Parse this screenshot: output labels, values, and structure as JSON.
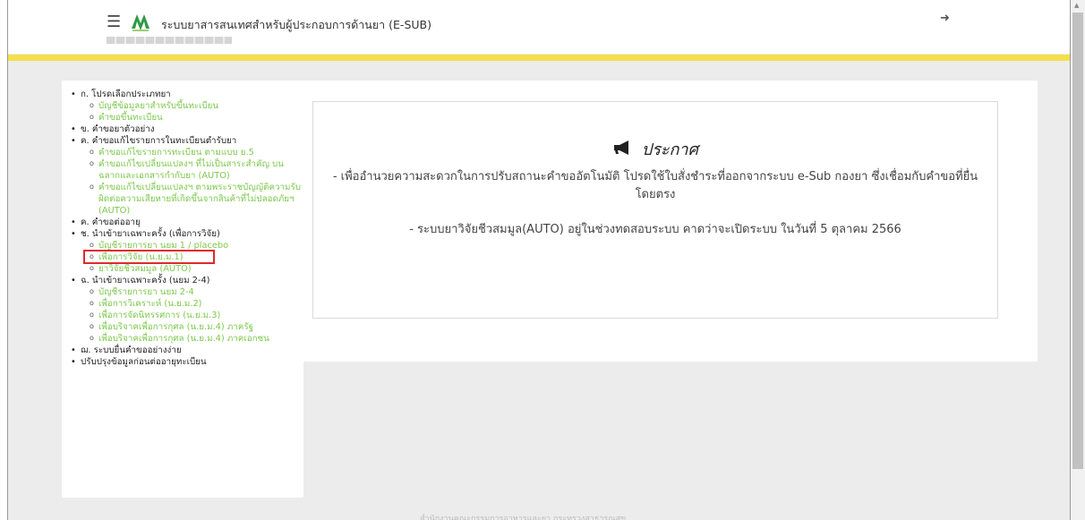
{
  "header": {
    "title": "ระบบยาสารสนเทศสำหรับผู้ประกอบการด้านยา (E-SUB)",
    "menu_icon": "menu-icon",
    "logout_icon": "sign-out-icon",
    "accent_color": "#f3e04a"
  },
  "sidebar": {
    "items": [
      {
        "label": "ก. โปรดเลือกประเภทยา",
        "children": [
          "บัญชีข้อมูลยาสำหรับขึ้นทะเบียน",
          "คำขอขึ้นทะเบียน"
        ]
      },
      {
        "label": "ข. คำขอยาตัวอย่าง",
        "children": []
      },
      {
        "label": "ค. คำขอแก้ไขรายการในทะเบียนตำรับยา",
        "children": [
          "คำขอแก้ไขรายการทะเบียน ตามแบบ ย.5",
          "คำขอแก้ไขเปลี่ยนแปลงฯ ที่ไม่เป็นสาระสำคัญ บนฉลากและเอกสารกำกับยา (AUTO)",
          "คำขอแก้ไขเปลี่ยนแปลงฯ ตามพระราชบัญญัติความรับผิดต่อความเสียหายที่เกิดขึ้นจากสินค้าที่ไม่ปลอดภัยฯ (AUTO)"
        ]
      },
      {
        "label": "ค. คำขอต่ออายุ",
        "children": []
      },
      {
        "label": "ช. นำเข้ายาเฉพาะครั้ง (เพื่อการวิจัย)",
        "children": [
          "บัญชีรายการยา นยม 1 / placebo",
          "เพื่อการวิจัย (น.ย.ม.1)",
          "ยาวิจัยชีวสมมูล (AUTO)"
        ]
      },
      {
        "label": "ฉ. นำเข้ายาเฉพาะครั้ง (นยม 2-4)",
        "children": [
          "บัญชีรายการยา นยม 2-4",
          "เพื่อการวิเคราะห์ (น.ย.ม.2)",
          "เพื่อการจัดนิทรรศการ (น.ย.ม.3)",
          "เพื่อบริจาคเพื่อการกุศล (น.ย.ม.4) ภาครัฐ",
          "เพื่อบริจาคเพื่อการกุศล (น.ย.ม.4) ภาคเอกชน"
        ]
      },
      {
        "label": "ฌ. ระบบยื่นคำขออย่างง่าย",
        "children": []
      },
      {
        "label": "ปรับปรุงข้อมูลก่อนต่ออายุทะเบียน",
        "children": []
      }
    ],
    "highlighted": "เพื่อการวิจัย (น.ย.ม.1)"
  },
  "announcement": {
    "icon": "megaphone-icon",
    "title": "ประกาศ",
    "line1": "- เพื่ออำนวยความสะดวกในการปรับสถานะคำขออัตโนมัติ โปรดใช้ใบสั่งชำระที่ออกจากระบบ e-Sub กองยา ซึ่งเชื่อมกับคำขอที่ยื่นโดยตรง",
    "line2": "- ระบบยาวิจัยชีวสมมูล(AUTO) อยู่ในช่วงทดสอบระบบ คาดว่าจะเปิดระบบ ในวันที่ 5 ตุลาคม 2566"
  },
  "footer": {
    "text": "สำนักงานคณะกรรมการอาหารและยา กระทรวงสาธารณสุข"
  }
}
